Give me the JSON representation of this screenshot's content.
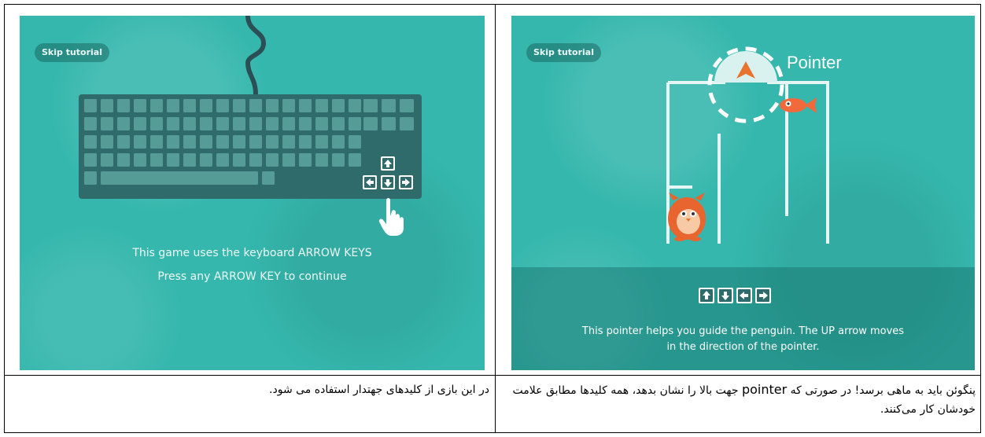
{
  "left_screen": {
    "skip_label": "Skip tutorial",
    "caption_line1": "This game uses the keyboard ARROW KEYS",
    "caption_line2": "Press any ARROW KEY to continue",
    "icons": [
      "keyboard-icon",
      "arrow-up-key-icon",
      "arrow-left-key-icon",
      "arrow-down-key-icon",
      "arrow-right-key-icon",
      "hand-pointer-icon"
    ]
  },
  "right_screen": {
    "skip_label": "Skip tutorial",
    "pointer_label": "Pointer",
    "caption_line1": "This pointer helps you guide the penguin. The UP arrow moves",
    "caption_line2": "in the direction of the pointer.",
    "icons": [
      "pointer-arrow-icon",
      "fish-icon",
      "penguin-icon",
      "arrow-up-key-icon",
      "arrow-down-key-icon",
      "arrow-left-key-icon",
      "arrow-right-key-icon"
    ]
  },
  "table": {
    "left_text": "در این بازی از کلیدهای جهتدار استفاده می شود.",
    "right_text_before": "پنگوئن باید به ماهی برسد! در صورتی که ",
    "right_text_keyword": "pointer",
    "right_text_after": " جهت بالا را نشان بدهد، همه کلیدها مطابق علامت خودشان کار می‌کنند."
  },
  "colors": {
    "screen_teal": "#35b7ad",
    "keyboard": "#2f6b6b",
    "fish": "#f26a3b",
    "pointer": "#e8742f"
  }
}
